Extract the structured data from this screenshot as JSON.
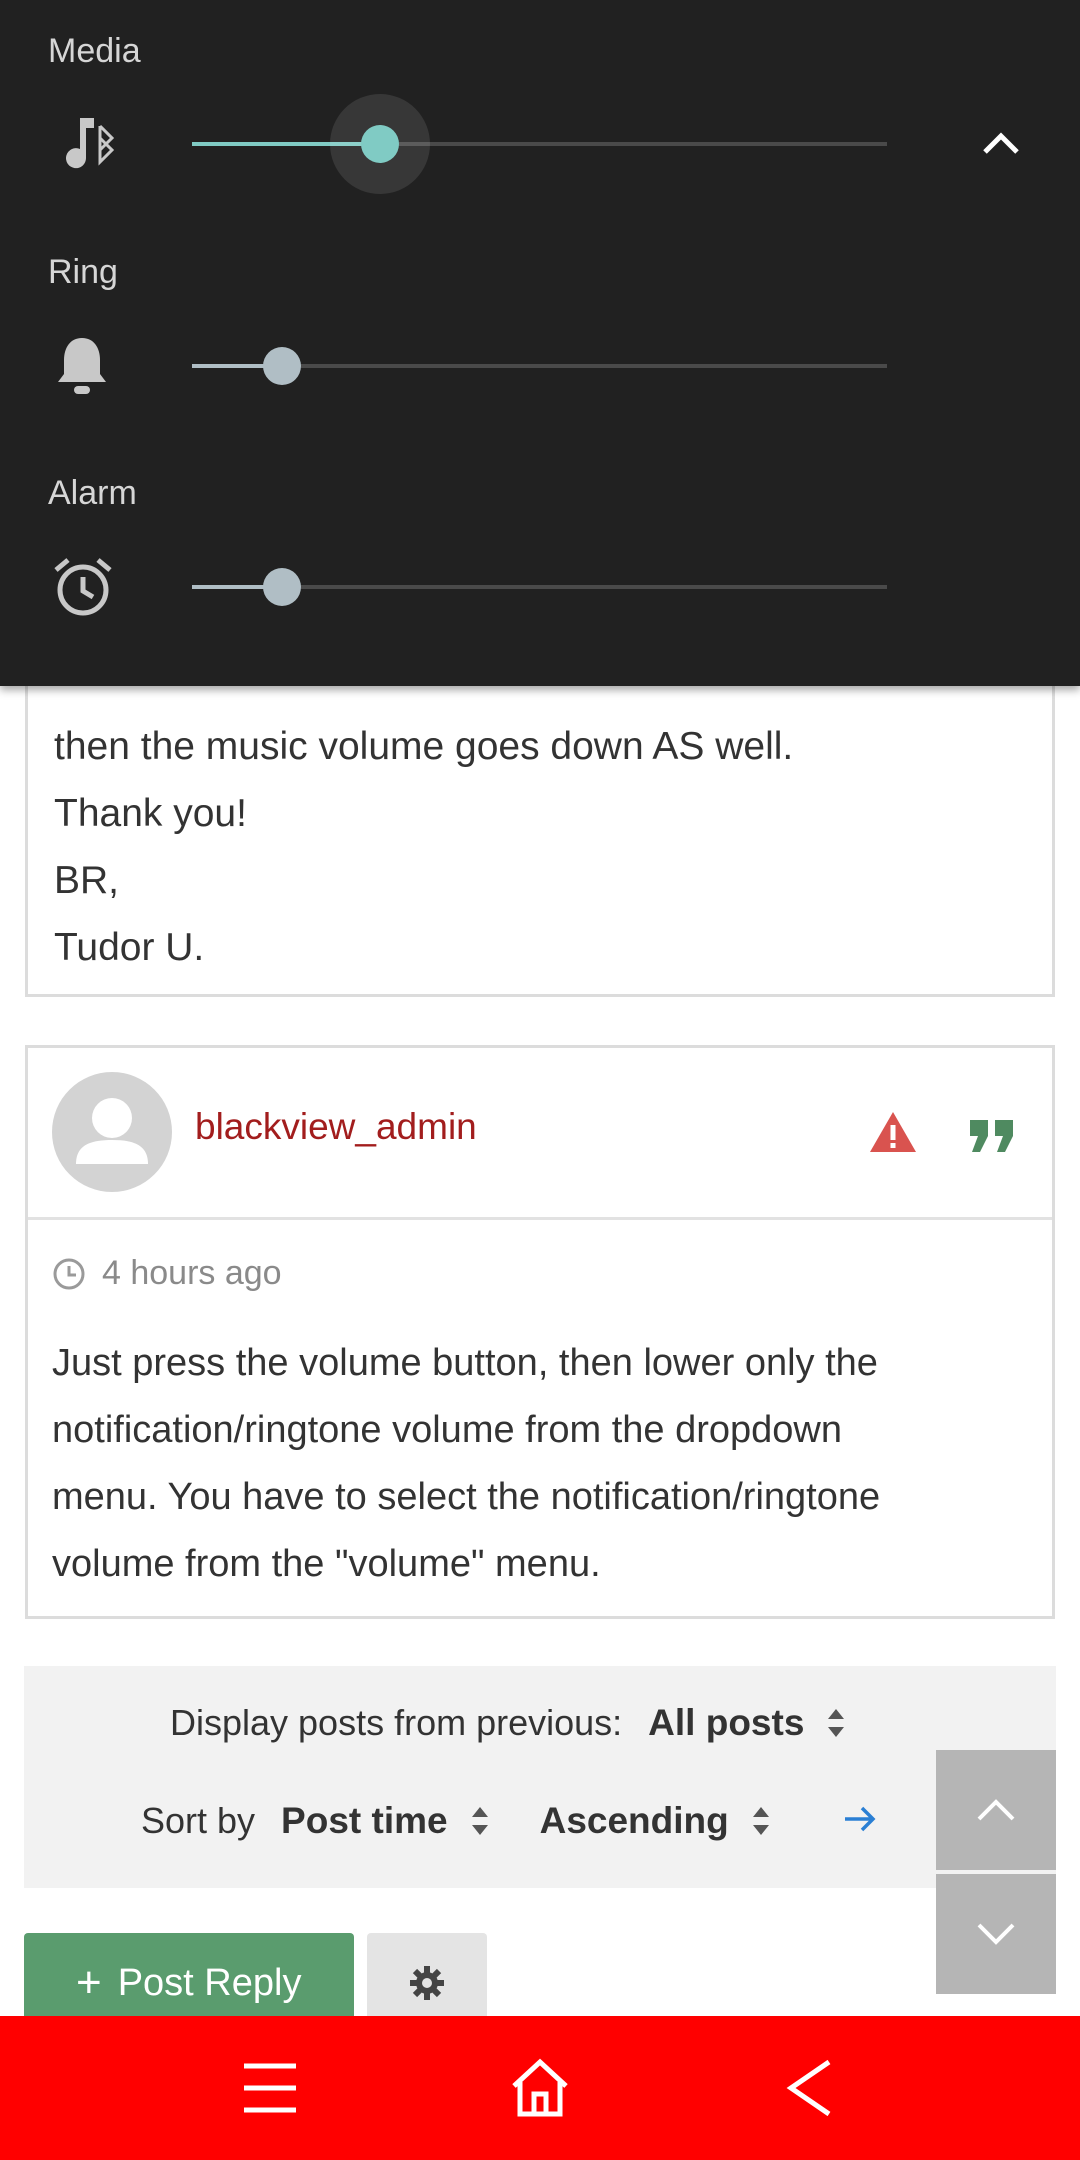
{
  "volume_panel": {
    "media": {
      "label": "Media",
      "level": 0.27,
      "icon": "music-bluetooth-icon",
      "active": true
    },
    "ring": {
      "label": "Ring",
      "level": 0.13,
      "icon": "bell-icon"
    },
    "alarm": {
      "label": "Alarm",
      "level": 0.13,
      "icon": "alarm-clock-icon"
    },
    "collapse_icon": "chevron-up-icon",
    "colors": {
      "panel_bg": "#212121",
      "active_accent": "#80cbc4",
      "inactive_thumb": "#b0bec5",
      "track": "#4a4a4a"
    }
  },
  "previous_post": {
    "lines": [
      "then the music volume goes down AS well.",
      "Thank you!",
      "BR,",
      "Tudor U."
    ]
  },
  "post": {
    "username": "blackview_admin",
    "username_color": "#a21d1d",
    "timestamp": "4 hours ago",
    "icons": [
      "report-warning-icon",
      "quote-icon",
      "clock-icon",
      "avatar-placeholder-icon"
    ],
    "body_lines": [
      "Just press the volume button, then lower only the",
      "notification/ringtone volume from the dropdown",
      "menu. You have to select the notification/ringtone",
      "volume from the \"volume\" menu."
    ]
  },
  "filters": {
    "display_label": "Display posts from previous:",
    "display_value": "All posts",
    "sort_label": "Sort by",
    "sort_value": "Post time",
    "order_value": "Ascending",
    "go_icon": "arrow-right-icon"
  },
  "actions": {
    "post_reply_plus": "+",
    "post_reply_label": "Post Reply",
    "post_reply_color": "#5a9c6e",
    "tools_icon": "gear-icon"
  },
  "scroll_controls": {
    "up_icon": "chevron-up-icon",
    "down_icon": "chevron-down-icon"
  },
  "navbar": {
    "color": "#ff0000",
    "buttons": [
      "menu-icon",
      "home-icon",
      "back-icon"
    ]
  }
}
